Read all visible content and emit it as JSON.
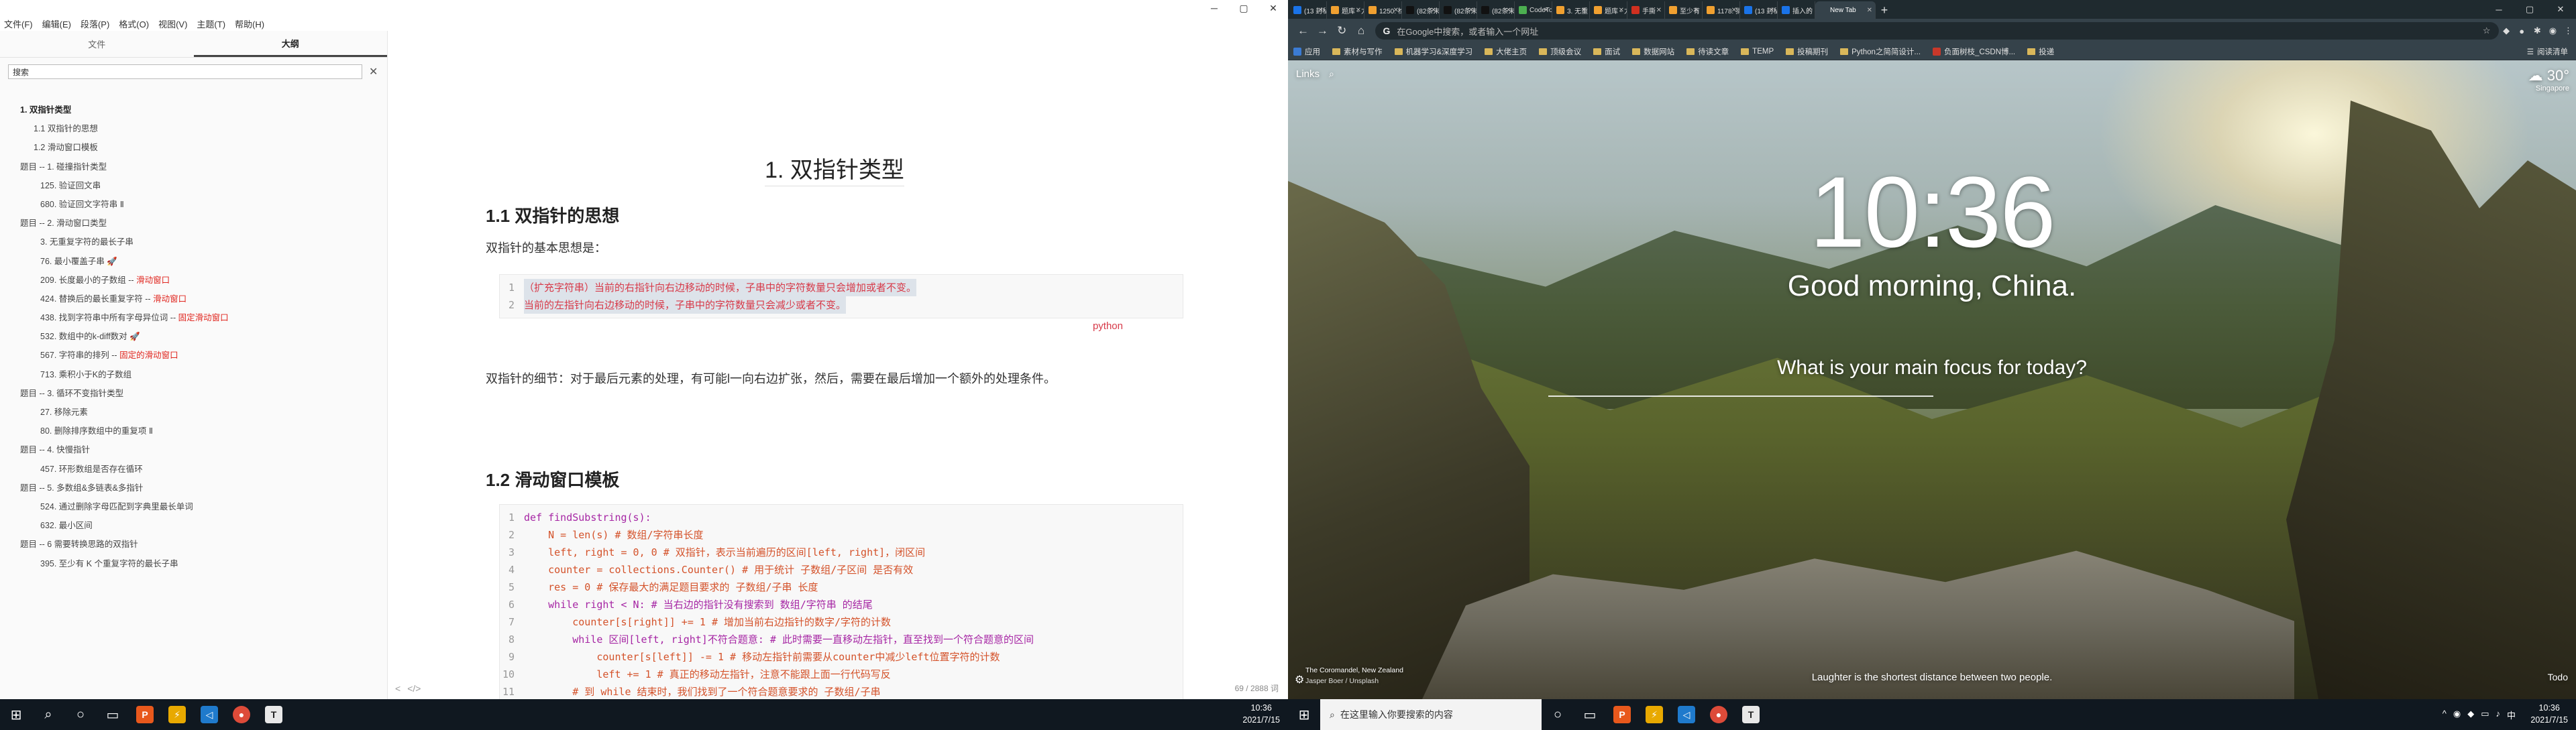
{
  "left": {
    "menu": [
      "文件(F)",
      "编辑(E)",
      "段落(P)",
      "格式(O)",
      "视图(V)",
      "主题(T)",
      "帮助(H)"
    ],
    "window_controls": [
      "─",
      "▢",
      "✕"
    ],
    "sidebar": {
      "tabs": [
        "文件",
        "大纲"
      ],
      "active_tab": "大纲",
      "search_value": "搜索",
      "clear_icon": "✕",
      "outline": [
        {
          "level": 1,
          "text": "1. 双指针类型"
        },
        {
          "level": 2,
          "text": "1.1 双指针的思想"
        },
        {
          "level": 2,
          "text": "1.2 滑动窗口模板"
        },
        {
          "level": 1,
          "text": "题目 -- 1. 碰撞指针类型",
          "plain": true
        },
        {
          "level": 3,
          "text": "125. 验证回文串"
        },
        {
          "level": 3,
          "text": "680. 验证回文字符串 Ⅱ"
        },
        {
          "level": 1,
          "text": "题目 -- 2. 滑动窗口类型",
          "plain": true
        },
        {
          "level": 3,
          "text": "3. 无重复字符的最长子串"
        },
        {
          "level": 3,
          "text": "76. 最小覆盖子串 🚀"
        },
        {
          "level": 3,
          "text": "209. 长度最小的子数组 -- ",
          "red": "滑动窗口"
        },
        {
          "level": 3,
          "text": "424. 替换后的最长重复字符 -- ",
          "red": "滑动窗口"
        },
        {
          "level": 3,
          "text": "438. 找到字符串中所有字母异位词 -- ",
          "red": "固定滑动窗口"
        },
        {
          "level": 3,
          "text": "532. 数组中的k-diff数对 🚀"
        },
        {
          "level": 3,
          "text": "567. 字符串的排列 -- ",
          "red": "固定的滑动窗口"
        },
        {
          "level": 3,
          "text": "713. 乘积小于K的子数组"
        },
        {
          "level": 1,
          "text": "题目 -- 3. 循环不变指针类型",
          "plain": true
        },
        {
          "level": 3,
          "text": "27. 移除元素"
        },
        {
          "level": 3,
          "text": "80. 删除排序数组中的重复项 Ⅱ"
        },
        {
          "level": 1,
          "text": "题目 -- 4. 快慢指针",
          "plain": true
        },
        {
          "level": 3,
          "text": "457. 环形数组是否存在循环"
        },
        {
          "level": 1,
          "text": "题目 -- 5. 多数组&多链表&多指针",
          "plain": true
        },
        {
          "level": 3,
          "text": "524. 通过删除字母匹配到字典里最长单词"
        },
        {
          "level": 3,
          "text": "632. 最小区间"
        },
        {
          "level": 1,
          "text": "题目 -- 6 需要转换思路的双指针",
          "plain": true
        },
        {
          "level": 3,
          "text": "395. 至少有 K 个重复字符的最长子串"
        }
      ]
    },
    "doc": {
      "h1": "1. 双指针类型",
      "h2_1": "1.1 双指针的思想",
      "p1": "双指针的基本思想是：",
      "code1": [
        "（扩充字符串）当前的右指针向右边移动的时候，子串中的字符数量只会增加或者不变。",
        "当前的左指针向右边移动的时候，子串中的字符数量只会减少或者不变。"
      ],
      "code1_lang": "python",
      "p2": "双指针的细节：对于最后元素的处理，有可能l一向右边扩张，然后，需要在最后增加一个额外的处理条件。",
      "h2_2": "1.2 滑动窗口模板",
      "code2": [
        "def findSubstring(s):",
        "    N = len(s) # 数组/字符串长度",
        "    left, right = 0, 0 # 双指针，表示当前遍历的区间[left, right]，闭区间",
        "    counter = collections.Counter() # 用于统计 子数组/子区间 是否有效",
        "    res = 0 # 保存最大的满足题目要求的 子数组/子串 长度",
        "    while right < N: # 当右边的指针没有搜索到 数组/字符串 的结尾",
        "        counter[s[right]] += 1 # 增加当前右边指针的数字/字符的计数",
        "        while 区间[left, right]不符合题意: # 此时需要一直移动左指针，直至找到一个符合题意的区间",
        "            counter[s[left]] -= 1 # 移动左指针前需要从counter中减少left位置字符的计数",
        "            left += 1 # 真正的移动左指针，注意不能跟上面一行代码写反",
        "        # 到 while 结束时，我们找到了一个符合题意要求的 子数组/子串"
      ]
    },
    "status": {
      "nav_left": "<",
      "code_icon": "</>",
      "word_count": "69 / 2888 词"
    },
    "taskbar": {
      "time": "10:36",
      "date": "2021/7/15"
    }
  },
  "right": {
    "tabs": [
      {
        "label": "(13 封私",
        "color": "#1a73e8"
      },
      {
        "label": "题库 - 力",
        "color": "#f0a030"
      },
      {
        "label": "1250. 检",
        "color": "#f0a030"
      },
      {
        "label": "(82条未",
        "color": "#111111"
      },
      {
        "label": "(82条未",
        "color": "#111111"
      },
      {
        "label": "(82条未",
        "color": "#111111"
      },
      {
        "label": "CodeTo",
        "color": "#4caf50"
      },
      {
        "label": "3. 无重",
        "color": "#f0a030"
      },
      {
        "label": "题库 - 力",
        "color": "#f0a030"
      },
      {
        "label": "手撕",
        "color": "#d03020"
      },
      {
        "label": "至少有 K",
        "color": "#f0a030"
      },
      {
        "label": "1178. 猜",
        "color": "#f0a030"
      },
      {
        "label": "(13 封私",
        "color": "#1a73e8"
      },
      {
        "label": "插入的",
        "color": "#1a73e8"
      },
      {
        "label": "New Tab",
        "color": "#35424a",
        "active": true
      }
    ],
    "omnibox_placeholder": "在Google中搜索，或者输入一个网址",
    "bookmarks": [
      {
        "label": "应用",
        "type": "grid"
      },
      {
        "label": "素材与写作",
        "type": "folder"
      },
      {
        "label": "机器学习&深度学习",
        "type": "folder"
      },
      {
        "label": "大佬主页",
        "type": "folder"
      },
      {
        "label": "顶级会议",
        "type": "folder"
      },
      {
        "label": "面试",
        "type": "folder"
      },
      {
        "label": "数据网站",
        "type": "folder"
      },
      {
        "label": "待读文章",
        "type": "folder"
      },
      {
        "label": "TEMP",
        "type": "folder"
      },
      {
        "label": "投稿期刊",
        "type": "folder"
      },
      {
        "label": "Python之简简设计...",
        "type": "folder"
      },
      {
        "label": "负面树枝_CSDN博...",
        "type": "red"
      },
      {
        "label": "投递",
        "type": "folder"
      }
    ],
    "reading_list": "阅读清单",
    "momentum": {
      "links": "Links",
      "temp": "30°",
      "location": "Singapore",
      "time": "10:36",
      "greeting": "Good morning, China.",
      "focus": "What is your main focus for today?",
      "photo_location": "The Coromandel, New Zealand",
      "photo_by": "Jasper Boer / Unsplash",
      "quote": "Laughter is the shortest distance between two people.",
      "todo": "Todo"
    },
    "taskbar": {
      "search": "在这里输入你要搜索的内容",
      "time": "10:36",
      "date": "2021/7/15"
    }
  }
}
